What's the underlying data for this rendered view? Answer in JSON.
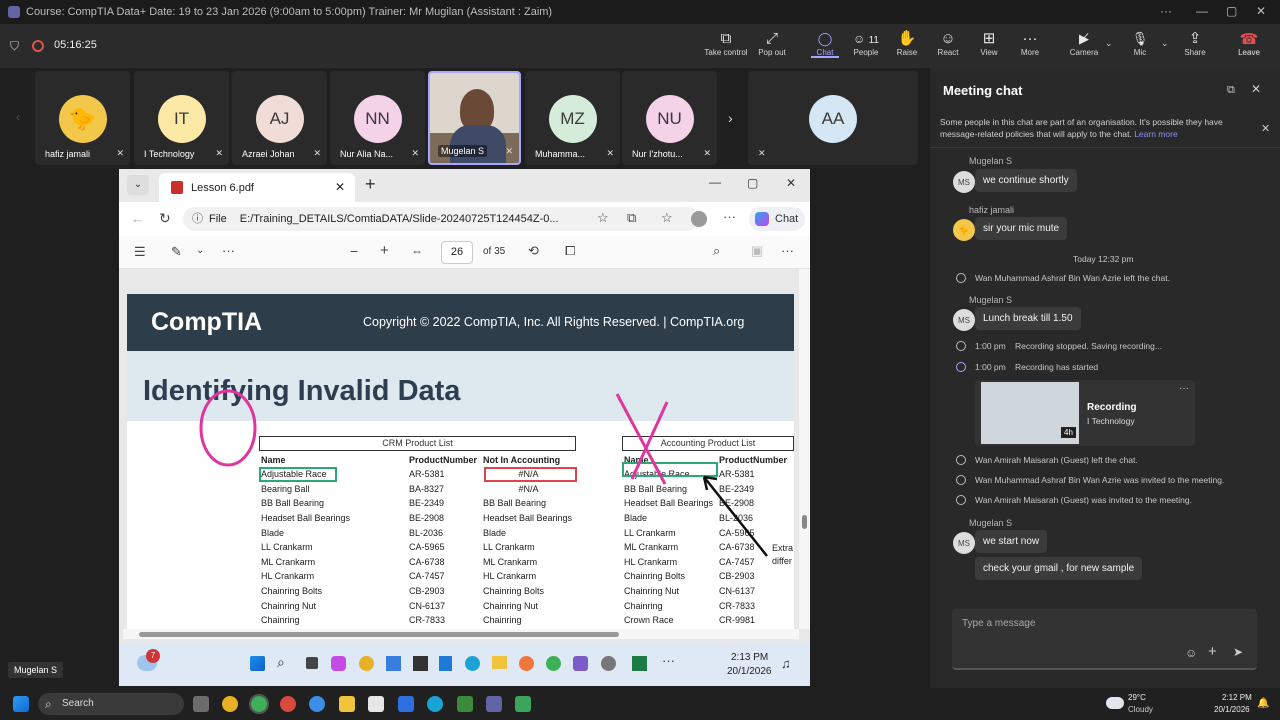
{
  "window": {
    "title": "Course: CompTIA Data+ Date: 19 to 23 Jan 2026 (9:00am to 5:00pm) Trainer: Mr Mugilan (Assistant : Zaim)",
    "more": "···",
    "minimize": "—",
    "maximize": "▢",
    "close": "✕"
  },
  "meeting": {
    "timer": "05:16:25",
    "toolbar": [
      {
        "id": "take-control",
        "label": "Take control",
        "icon": "⧉"
      },
      {
        "id": "pop-out",
        "label": "Pop out",
        "icon": "⤢"
      },
      {
        "id": "chat",
        "label": "Chat",
        "icon": "💬"
      },
      {
        "id": "people",
        "label": "People",
        "icon": "👥",
        "count": "11"
      },
      {
        "id": "raise",
        "label": "Raise",
        "icon": "✋"
      },
      {
        "id": "react",
        "label": "React",
        "icon": "☺"
      },
      {
        "id": "view",
        "label": "View",
        "icon": "⊞"
      },
      {
        "id": "more",
        "label": "More",
        "icon": "···"
      },
      {
        "id": "camera",
        "label": "Camera",
        "icon": "🎥"
      },
      {
        "id": "mic",
        "label": "Mic",
        "icon": "🎤"
      },
      {
        "id": "share",
        "label": "Share",
        "icon": "⇪"
      }
    ],
    "leave_label": "Leave",
    "leave_icon": "☎"
  },
  "participants": [
    {
      "name": "hafiz jamali",
      "initials": "",
      "color": "#f3c84a",
      "emoji": "🐤"
    },
    {
      "name": "I Technology",
      "initials": "IT",
      "color": "#fce9a5"
    },
    {
      "name": "Azraei Johan",
      "initials": "AJ",
      "color": "#f0ddd8"
    },
    {
      "name": "Nur Alia Na...",
      "initials": "NN",
      "color": "#f4d2e8"
    },
    {
      "name": "Mugelan S",
      "initials": "",
      "color": "#8a8a8a",
      "photo": true
    },
    {
      "name": "Muhamma...",
      "initials": "MZ",
      "color": "#d6ecda"
    },
    {
      "name": "Nur I'zhotu...",
      "initials": "NU",
      "color": "#f4d2e8"
    },
    {
      "name": "",
      "initials": "AA",
      "color": "#d5e6f4"
    }
  ],
  "browser": {
    "tab_title": "Lesson 6.pdf",
    "url_prefix": "File",
    "url": "E:/Training_DETAILS/ComtiaDATA/Slide-20240725T124454Z-0...",
    "chat_label": "Chat",
    "page_current": "26",
    "page_total": "of 35"
  },
  "slide": {
    "logo": "CompTIA",
    "copyright": "Copyright © 2022 CompTIA, Inc. All Rights Reserved.  |  CompTIA.org",
    "title": "Identifying Invalid Data",
    "crm_header": "CRM Product List",
    "acct_header": "Accounting Product List",
    "annotation": "Extra",
    "annotation2": "differ",
    "crm_columns": [
      "Name",
      "ProductNumber",
      "Not In Accounting"
    ],
    "crm_rows": [
      [
        "Adjustable Race",
        "AR-5381",
        "#N/A"
      ],
      [
        "Bearing Ball",
        "BA-8327",
        "#N/A"
      ],
      [
        "BB Ball Bearing",
        "BE-2349",
        "BB Ball Bearing"
      ],
      [
        "Headset Ball Bearings",
        "BE-2908",
        "Headset Ball Bearings"
      ],
      [
        "Blade",
        "BL-2036",
        "Blade"
      ],
      [
        "LL Crankarm",
        "CA-5965",
        "LL Crankarm"
      ],
      [
        "ML Crankarm",
        "CA-6738",
        "ML Crankarm"
      ],
      [
        "HL Crankarm",
        "CA-7457",
        "HL Crankarm"
      ],
      [
        "Chainring Bolts",
        "CB-2903",
        "Chainring Bolts"
      ],
      [
        "Chainring Nut",
        "CN-6137",
        "Chainring Nut"
      ],
      [
        "Chainring",
        "CR-7833",
        "Chainring"
      ]
    ],
    "acct_columns": [
      "Name",
      "ProductNumber"
    ],
    "acct_rows": [
      [
        "Adjustable Race",
        "AR-5381"
      ],
      [
        "BB Ball Bearing",
        "BE-2349"
      ],
      [
        "Headset Ball Bearings",
        "BE-2908"
      ],
      [
        "Blade",
        "BL-2036"
      ],
      [
        "LL Crankarm",
        "CA-5965"
      ],
      [
        "ML Crankarm",
        "CA-6738"
      ],
      [
        "HL Crankarm",
        "CA-7457"
      ],
      [
        "Chainring Bolts",
        "CB-2903"
      ],
      [
        "Chainring Nut",
        "CN-6137"
      ],
      [
        "Chainring",
        "CR-7833"
      ],
      [
        "Crown Race",
        "CR-9981"
      ]
    ]
  },
  "inner_taskbar": {
    "badge": "7",
    "time": "2:13 PM",
    "date": "20/1/2026"
  },
  "chat": {
    "title": "Meeting chat",
    "notice": "Some people in this chat are part of an organisation. It's possible they have message-related policies that will apply to the chat.",
    "learn_more": "Learn more",
    "m1_sender": "Mugelan S",
    "m1_text": "we continue shortly",
    "m2_sender": "hafiz jamali",
    "m2_text": "sir your mic mute",
    "day_sep": "Today 12:32 pm",
    "sys1": "Wan Muhammad Ashraf Bin Wan Azrie left the chat.",
    "m3_sender": "Mugelan S",
    "m3_text": "Lunch break till 1.50",
    "rec_stop_time": "1:00 pm",
    "rec_stop_text": "Recording stopped. Saving recording...",
    "rec_start_time": "1:00 pm",
    "rec_start_text": "Recording has started",
    "rec_card_title": "Recording",
    "rec_card_owner": "I Technology",
    "rec_card_duration": "4h",
    "sys2": "Wan Amirah Maisarah (Guest) left the chat.",
    "sys3": "Wan Muhammad Ashraf Bin Wan Azrie was invited to the meeting.",
    "sys4": "Wan Amirah Maisarah (Guest) was invited to the meeting.",
    "m4_sender": "Mugelan S",
    "m4_text": "we start now",
    "m5_text": "check your gmail , for new sample",
    "input_placeholder": "Type a message",
    "ms_initials": "MS"
  },
  "presenter_label": "Mugelan S",
  "taskbar": {
    "search": "Search",
    "weather_temp": "29°C",
    "weather_desc": "Cloudy",
    "time": "2:12 PM",
    "date": "20/1/2026"
  }
}
